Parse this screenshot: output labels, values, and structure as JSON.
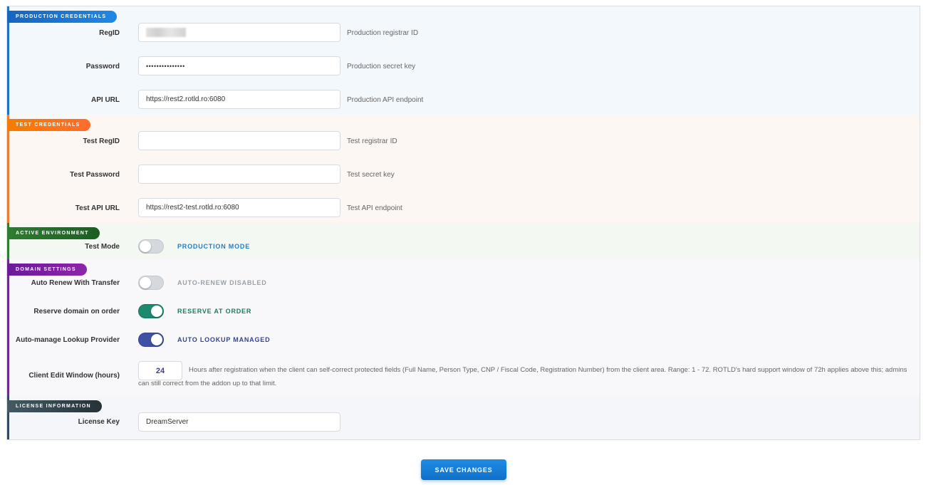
{
  "production": {
    "badge": "Production Credentials",
    "regid_label": "RegID",
    "regid_hint": "Production registrar ID",
    "password_label": "Password",
    "password_value": "•••••••••••••••",
    "password_hint": "Production secret key",
    "apiurl_label": "API URL",
    "apiurl_value": "https://rest2.rotld.ro:6080",
    "apiurl_hint": "Production API endpoint"
  },
  "test": {
    "badge": "Test Credentials",
    "regid_label": "Test RegID",
    "regid_hint": "Test registrar ID",
    "password_label": "Test Password",
    "password_hint": "Test secret key",
    "apiurl_label": "Test API URL",
    "apiurl_value": "https://rest2-test.rotld.ro:6080",
    "apiurl_hint": "Test API endpoint"
  },
  "environment": {
    "badge": "Active Environment",
    "testmode_label": "Test Mode",
    "testmode_on": false,
    "testmode_state": "Production Mode",
    "state_color": "#1f7fc8"
  },
  "domain": {
    "badge": "Domain Settings",
    "autorenew_label": "Auto Renew With Transfer",
    "autorenew_on": false,
    "autorenew_state": "Auto-Renew Disabled",
    "reserve_label": "Reserve domain on order",
    "reserve_on": true,
    "reserve_state": "Reserve at Order",
    "lookup_label": "Auto-manage Lookup Provider",
    "lookup_on": true,
    "lookup_state": "Auto Lookup Managed",
    "editwindow_label": "Client Edit Window (hours)",
    "editwindow_value": "24",
    "editwindow_hint": "Hours after registration when the client can self-correct protected fields (Full Name, Person Type, CNP / Fiscal Code, Registration Number) from the client area. Range: 1 - 72. ROTLD's hard support window of 72h applies above this; admins can still correct from the addon up to that limit."
  },
  "license": {
    "badge": "License Information",
    "key_label": "License Key",
    "key_value": "DreamServer"
  },
  "actions": {
    "save_label": "Save Changes"
  },
  "colors": {
    "production": "#1f72c4",
    "test": "#ec7b36",
    "environment": "#2e7d32",
    "domain": "#6a2c91",
    "license": "#34495e",
    "toggle_teal": "#1d8a70",
    "toggle_indigo": "#3f51a5",
    "save_button": "#1582d8"
  }
}
